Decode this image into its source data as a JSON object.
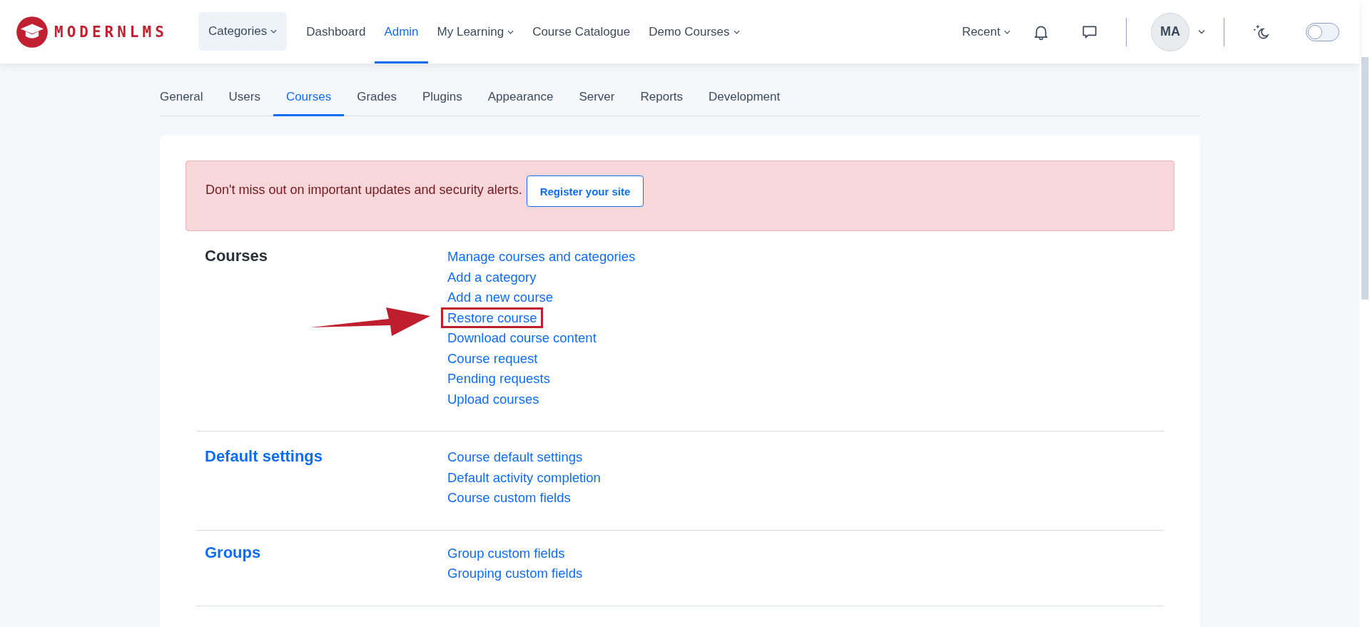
{
  "header": {
    "logo_text": "MODERNLMS",
    "nav": [
      {
        "label": "Categories",
        "dropdown": true,
        "selected": false,
        "kind": "box"
      },
      {
        "label": "Dashboard",
        "dropdown": false,
        "selected": false,
        "kind": "link"
      },
      {
        "label": "Admin",
        "dropdown": false,
        "selected": true,
        "kind": "link"
      },
      {
        "label": "My Learning",
        "dropdown": true,
        "selected": false,
        "kind": "link"
      },
      {
        "label": "Course Catalogue",
        "dropdown": false,
        "selected": false,
        "kind": "link"
      },
      {
        "label": "Demo Courses",
        "dropdown": true,
        "selected": false,
        "kind": "link"
      }
    ],
    "recent": {
      "label": "Recent",
      "dropdown": true
    },
    "avatar": {
      "initials": "MA"
    },
    "dark_mode_toggle": {
      "on": false
    }
  },
  "tabs": [
    {
      "label": "General",
      "selected": false
    },
    {
      "label": "Users",
      "selected": false
    },
    {
      "label": "Courses",
      "selected": true
    },
    {
      "label": "Grades",
      "selected": false
    },
    {
      "label": "Plugins",
      "selected": false
    },
    {
      "label": "Appearance",
      "selected": false
    },
    {
      "label": "Server",
      "selected": false
    },
    {
      "label": "Reports",
      "selected": false
    },
    {
      "label": "Development",
      "selected": false
    }
  ],
  "alert": {
    "text": "Don't miss out on important updates and security alerts.",
    "button": "Register your site"
  },
  "sections": [
    {
      "title": "Courses",
      "title_is_link": false,
      "links": [
        {
          "label": "Manage courses and categories",
          "highlighted": false
        },
        {
          "label": "Add a category",
          "highlighted": false
        },
        {
          "label": "Add a new course",
          "highlighted": false
        },
        {
          "label": "Restore course",
          "highlighted": true
        },
        {
          "label": "Download course content",
          "highlighted": false
        },
        {
          "label": "Course request",
          "highlighted": false
        },
        {
          "label": "Pending requests",
          "highlighted": false
        },
        {
          "label": "Upload courses",
          "highlighted": false
        }
      ]
    },
    {
      "title": "Default settings",
      "title_is_link": true,
      "links": [
        {
          "label": "Course default settings",
          "highlighted": false
        },
        {
          "label": "Default activity completion",
          "highlighted": false
        },
        {
          "label": "Course custom fields",
          "highlighted": false
        }
      ]
    },
    {
      "title": "Groups",
      "title_is_link": true,
      "links": [
        {
          "label": "Group custom fields",
          "highlighted": false
        },
        {
          "label": "Grouping custom fields",
          "highlighted": false
        }
      ]
    }
  ]
}
